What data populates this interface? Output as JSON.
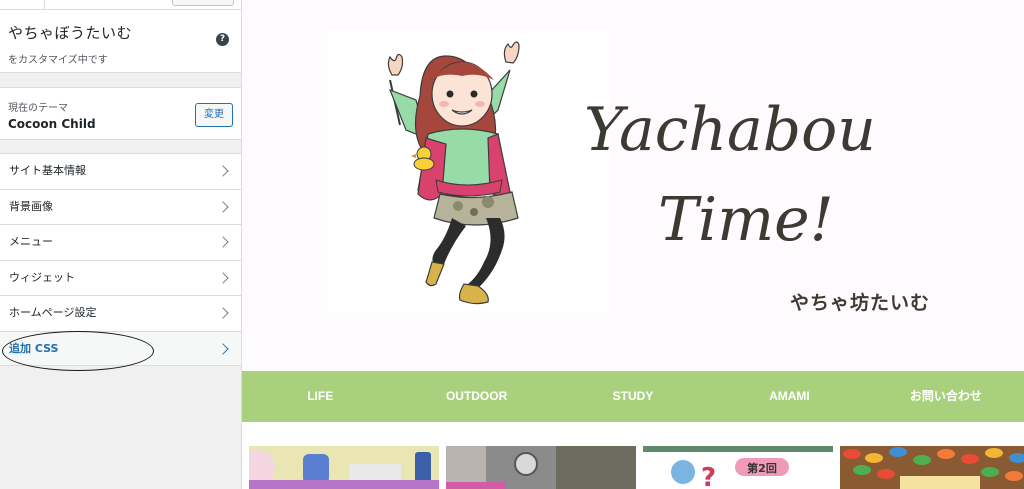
{
  "sidebar": {
    "site_title": "やちゃぼうたいむ",
    "site_subtitle": "をカスタマイズ中です",
    "help_icon_glyph": "?",
    "theme": {
      "label": "現在のテーマ",
      "name": "Cocoon Child",
      "change_label": "変更"
    },
    "menu": [
      {
        "label": "サイト基本情報",
        "icon": "chevron-right-icon"
      },
      {
        "label": "背景画像",
        "icon": "chevron-right-icon"
      },
      {
        "label": "メニュー",
        "icon": "chevron-right-icon"
      },
      {
        "label": "ウィジェット",
        "icon": "chevron-right-icon"
      },
      {
        "label": "ホームページ設定",
        "icon": "chevron-right-icon"
      },
      {
        "label": "追加 CSS",
        "icon": "chevron-right-icon"
      }
    ]
  },
  "preview": {
    "logo_line1": "Yachabou",
    "logo_line2": "Time!",
    "logo_sub": "やちゃ坊たいむ",
    "nav": [
      "LIFE",
      "OUTDOOR",
      "STUDY",
      "AMAMI",
      "お問い合わせ"
    ],
    "card3_badge": "第2回"
  },
  "colors": {
    "accent": "#2271b1",
    "nav_bg": "#a9d17d",
    "logo_ink": "#3b3a33"
  }
}
